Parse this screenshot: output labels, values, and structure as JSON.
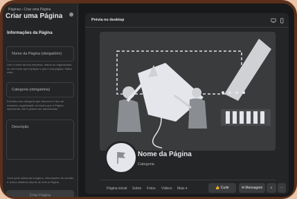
{
  "sidebar": {
    "breadcrumb": "Páginas › Criar uma Página",
    "title": "Criar uma Página",
    "section_title": "Informações da Página",
    "name_field": {
      "placeholder": "Nome da Página (obrigatório)"
    },
    "name_helper": "Use o nome da sua empresa, marca ou organização, ou um nome que explique o que é sua página. Saiba mais",
    "category_field": {
      "placeholder": "Categoria (obrigatória)"
    },
    "category_helper": "Escolha uma categoria que descreva o tipo de empresa, organização ou tópico que a Página representa. Até 3 podem ser adicionadas.",
    "description_field": {
      "placeholder": "Descrição"
    },
    "bottom_helper": "Você pode adicionar imagens, informações de contato e outros detalhes depois de criar a Página.",
    "create_button": "Criar Página"
  },
  "preview": {
    "label": "Prévia no desktop",
    "page_name": "Nome da Página",
    "category": "Categoria",
    "nav": [
      "Página inicial",
      "Sobre",
      "Fotos",
      "Vídeos",
      "Mais ▾"
    ],
    "like_button": "Curtir",
    "message_button": "Mensagem",
    "icons": [
      "desktop-icon",
      "mobile-icon",
      "like-icon",
      "messenger-icon",
      "search-icon",
      "more-icon",
      "flag-icon"
    ]
  },
  "colors": {
    "background": "#18191a",
    "panel": "#242526",
    "text_primary": "#e4e6eb",
    "text_secondary": "#b0b3b8",
    "frame": "#5a2f1c"
  }
}
